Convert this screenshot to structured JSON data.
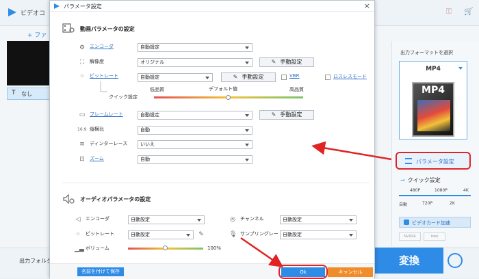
{
  "background": {
    "app_title": "ビデオコ",
    "add_files_label": "ファ",
    "subtitle_value": "なし",
    "output_folder_label": "出力フォルダ",
    "output_format_title": "出力フォーマットを選択",
    "format_name": "MP4",
    "format_icon_label": "MP4",
    "param_button_label": "パラメータ設定",
    "quick_setting_label": "クイック設定",
    "quick_levels_top": [
      "480P",
      "1080P",
      "4K"
    ],
    "quick_levels_bottom": [
      "自動",
      "720P",
      "2K"
    ],
    "gpu_accel_label": "ビデオカード加速",
    "gpu_brands": [
      "NVIDIA",
      "Intel"
    ],
    "convert_label": "変換"
  },
  "dialog": {
    "title": "パラメータ設定",
    "close": "×",
    "video_section_title": "動画パラメータの設定",
    "encoder_label": "エンコーダ",
    "encoder_value": "自動設定",
    "resolution_label": "解像度",
    "resolution_value": "オリジナル",
    "manual_label": "手動設定",
    "bitrate_label": "ビットレート",
    "bitrate_value": "自動設定",
    "vbr_label": "VBR",
    "lossless_label": "ロスレスモード",
    "quick_setting_label": "クイック設定",
    "low_quality": "低品質",
    "default_value": "デフォルト値",
    "high_quality": "高品質",
    "framerate_label": "フレームレート",
    "framerate_value": "自動設定",
    "aspect_label": "縦横比",
    "aspect_value": "自動",
    "deinterlace_label": "ディンターレース",
    "deinterlace_value": "いいえ",
    "zoom_label": "ズーム",
    "zoom_value": "自動",
    "audio_section_title": "オーディオパラメータの設定",
    "audio_encoder_label": "エンコーダ",
    "audio_encoder_value": "自動設定",
    "channel_label": "チャンネル",
    "channel_value": "自動設定",
    "audio_bitrate_label": "ビットレート",
    "audio_bitrate_value": "自動設定",
    "samplerate_label": "サンプリングレート",
    "samplerate_value": "自動設定",
    "volume_label": "ボリューム",
    "volume_percent": "100%",
    "volume_level": 0.5,
    "quality_level": 0.5,
    "save_name_button": "名前を付けて保存",
    "ok_button": "Ok",
    "cancel_button": "キャンセル"
  },
  "colors": {
    "accent": "#2e8be6",
    "annotation_red": "#e02424",
    "cancel_orange": "#f08c2a"
  }
}
